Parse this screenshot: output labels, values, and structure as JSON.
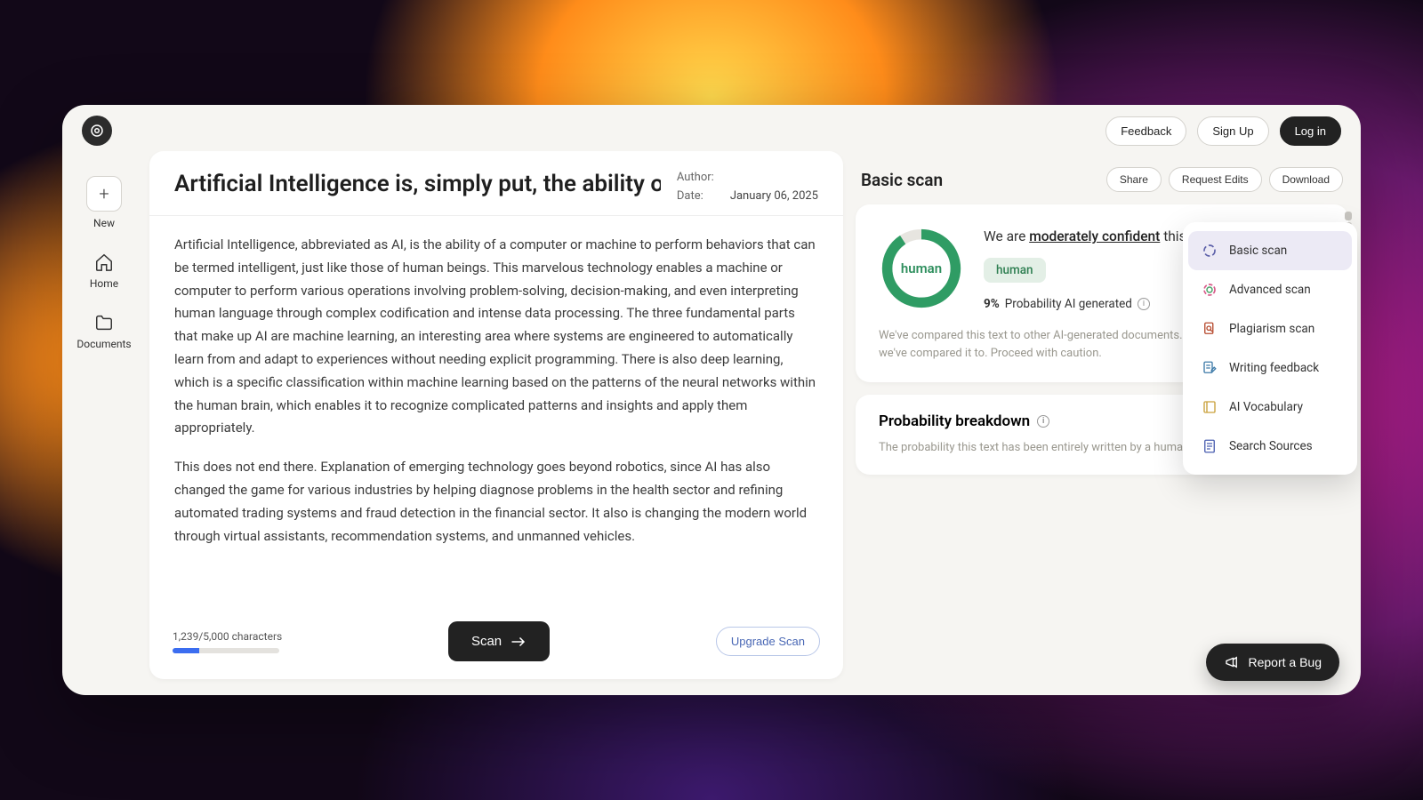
{
  "chart_data": {
    "type": "pie",
    "title": "AI-generated probability",
    "series": [
      {
        "name": "Human",
        "value": 91
      },
      {
        "name": "AI",
        "value": 9
      }
    ],
    "center_label": "human"
  },
  "topbar": {
    "feedback": "Feedback",
    "signup": "Sign Up",
    "login": "Log in"
  },
  "sidebar": {
    "new": "New",
    "home": "Home",
    "documents": "Documents"
  },
  "editor": {
    "title": "Artificial Intelligence is, simply put, the ability of a",
    "author_label": "Author:",
    "author_value": "",
    "date_label": "Date:",
    "date_value": "January 06, 2025",
    "para1": "Artificial Intelligence, abbreviated as AI, is the ability of a computer or machine to perform behaviors that can be termed intelligent, just like those of human beings. This marvelous technology enables a machine or computer to perform various operations involving problem-solving, decision-making, and even interpreting human language through complex codification and intense data processing. The three fundamental parts that make up AI are machine learning, an interesting area where systems are engineered to automatically learn from and adapt to experiences without needing explicit programming. There is also deep learning, which is a specific classification within machine learning based on the patterns of the neural networks within the human brain, which enables it to recognize complicated patterns and insights and apply them appropriately.",
    "para2": "This does not end there. Explanation of emerging technology goes beyond robotics, since AI has also changed the game for various industries by helping diagnose problems in the health sector and refining automated trading systems and fraud detection in the financial sector. It also is changing the modern world through virtual assistants, recommendation systems, and unmanned vehicles.",
    "char_count": "1,239/5,000 characters",
    "scan": "Scan",
    "upgrade": "Upgrade Scan"
  },
  "results": {
    "heading": "Basic scan",
    "share": "Share",
    "request_edits": "Request Edits",
    "download": "Download",
    "verdict_pre": "We are ",
    "verdict_link": "moderately confident",
    "verdict_post": " this text is entirely",
    "badge": "human",
    "prob_pct": "9%",
    "prob_label": " Probability AI generated",
    "note": "We've compared this text to other AI-generated documents. It's dissimilar to the data we've compared it to. Proceed with caution.",
    "donut_label": "human"
  },
  "breakdown": {
    "heading": "Probability breakdown",
    "text": "The probability this text has been entirely written by a human, AI or a mix of the two."
  },
  "menu": {
    "items": [
      "Basic scan",
      "Advanced scan",
      "Plagiarism scan",
      "Writing feedback",
      "AI Vocabulary",
      "Search Sources"
    ]
  },
  "report_bug": "Report a Bug"
}
